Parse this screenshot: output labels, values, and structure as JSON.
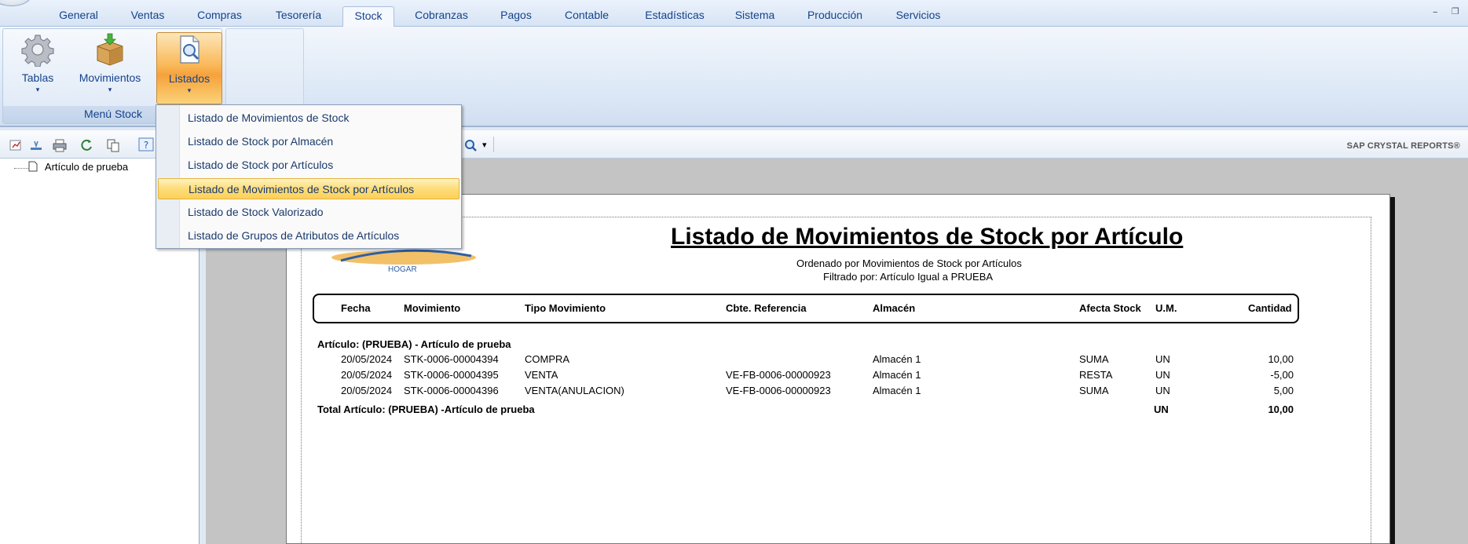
{
  "tabs": [
    "General",
    "Ventas",
    "Compras",
    "Tesorería",
    "Stock",
    "Cobranzas",
    "Pagos",
    "Contable",
    "Estadísticas",
    "Sistema",
    "Producción",
    "Servicios"
  ],
  "active_tab": "Stock",
  "window_controls": {
    "minimize": "–",
    "restore": "❐"
  },
  "ribbon": {
    "group_label": "Menú Stock",
    "buttons": [
      {
        "label": "Tablas",
        "icon": "gear-icon"
      },
      {
        "label": "Movimientos",
        "icon": "box-icon"
      },
      {
        "label": "Listados",
        "icon": "report-magnifier-icon"
      }
    ],
    "dropdown_arrow": "▾"
  },
  "dropdown": {
    "items": [
      "Listado de Movimientos de Stock",
      "Listado de Stock por Almacén",
      "Listado de Stock por Artículos",
      "Listado de Movimientos de Stock por Artículos",
      "Listado de Stock Valorizado",
      "Listado de Grupos de Atributos de Artículos"
    ],
    "highlighted_index": 3
  },
  "toolbar": {
    "brand": "SAP CRYSTAL REPORTS®",
    "zoom_arrow": "▾"
  },
  "tree": {
    "node": "Artículo de prueba"
  },
  "report": {
    "logo_text": "HOGAR",
    "title": "Listado de Movimientos de Stock por Artículo",
    "subtitle": "Ordenado por Movimientos de Stock por Artículos",
    "filter": "Filtrado por: Artículo Igual a PRUEBA",
    "headers": [
      "Fecha",
      "Movimiento",
      "Tipo Movimiento",
      "Cbte. Referencia",
      "Almacén",
      "Afecta Stock",
      "U.M.",
      "Cantidad"
    ],
    "group_header": "Artículo: (PRUEBA)  - Artículo de prueba",
    "rows": [
      {
        "fecha": "20/05/2024",
        "movimiento": "STK-0006-00004394",
        "tipo": "COMPRA",
        "referencia": "",
        "almacen": "Almacén 1",
        "afecta": "SUMA",
        "um": "UN",
        "cantidad": "10,00"
      },
      {
        "fecha": "20/05/2024",
        "movimiento": "STK-0006-00004395",
        "tipo": "VENTA",
        "referencia": "VE-FB-0006-00000923",
        "almacen": "Almacén 1",
        "afecta": "RESTA",
        "um": "UN",
        "cantidad": "-5,00"
      },
      {
        "fecha": "20/05/2024",
        "movimiento": "STK-0006-00004396",
        "tipo": "VENTA(ANULACION)",
        "referencia": "VE-FB-0006-00000923",
        "almacen": "Almacén 1",
        "afecta": "SUMA",
        "um": "UN",
        "cantidad": "5,00"
      }
    ],
    "total": {
      "label": "Total Artículo: (PRUEBA) -Artículo de prueba",
      "um": "UN",
      "cantidad": "10,00"
    }
  }
}
